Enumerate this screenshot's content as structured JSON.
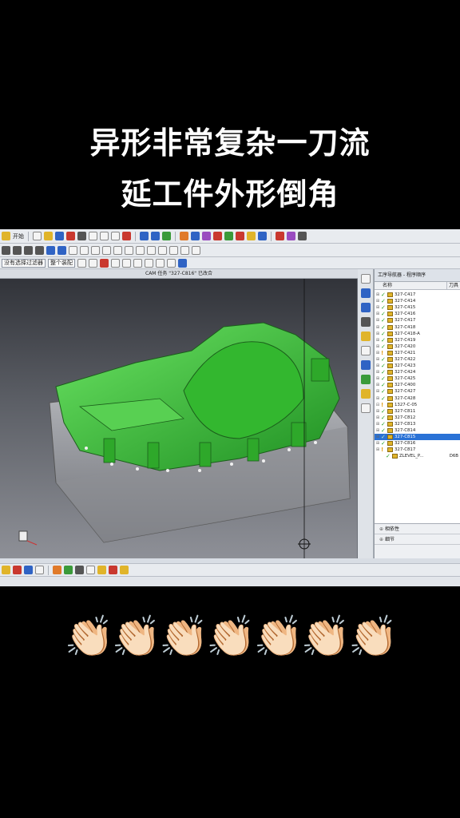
{
  "caption": {
    "line1": "异形非常复杂一刀流",
    "line2": "延工件外形倒角"
  },
  "toolbar": {
    "start_label": "开始",
    "combo_left": "没有选择过滤器",
    "combo_right": "整个装配"
  },
  "viewport": {
    "title": "CAM 任务 \"327-C816\" 已改合",
    "model_color": "#3ec43a"
  },
  "navigator": {
    "title": "工序导航器 - 程序顺序",
    "col_name": "名称",
    "col_tool": "刀具",
    "operations": [
      {
        "name": "327-C417",
        "status": "ok"
      },
      {
        "name": "327-C414",
        "status": "ok"
      },
      {
        "name": "327-C415",
        "status": "ok"
      },
      {
        "name": "327-C416",
        "status": "ok"
      },
      {
        "name": "327-C417",
        "status": "ok"
      },
      {
        "name": "327-C418",
        "status": "ok"
      },
      {
        "name": "327-C418-A",
        "status": "ok"
      },
      {
        "name": "327-C419",
        "status": "ok"
      },
      {
        "name": "327-C420",
        "status": "ok"
      },
      {
        "name": "327-C421",
        "status": "warn"
      },
      {
        "name": "327-C422",
        "status": "ok"
      },
      {
        "name": "327-C423",
        "status": "ok"
      },
      {
        "name": "327-C424",
        "status": "ok"
      },
      {
        "name": "327-C425",
        "status": "ok"
      },
      {
        "name": "327-C400",
        "status": "ok"
      },
      {
        "name": "327-C427",
        "status": "ok"
      },
      {
        "name": "327-C428",
        "status": "ok"
      },
      {
        "name": "1327-C-05",
        "status": "group"
      },
      {
        "name": "327-C811",
        "status": "ok"
      },
      {
        "name": "327-C812",
        "status": "ok"
      },
      {
        "name": "327-C813",
        "status": "ok"
      },
      {
        "name": "327-C814",
        "status": "ok"
      },
      {
        "name": "327-C815",
        "status": "selected"
      },
      {
        "name": "327-C816",
        "status": "ok"
      },
      {
        "name": "327-C817",
        "status": "warn"
      },
      {
        "name": "ZLEVEL_P...",
        "status": "sub",
        "tool": "D6B"
      }
    ],
    "dependencies_label": "相依性",
    "details_label": "细节"
  },
  "claps": "👏🏻👏🏻👏🏻👏🏻👏🏻👏🏻👏🏻"
}
